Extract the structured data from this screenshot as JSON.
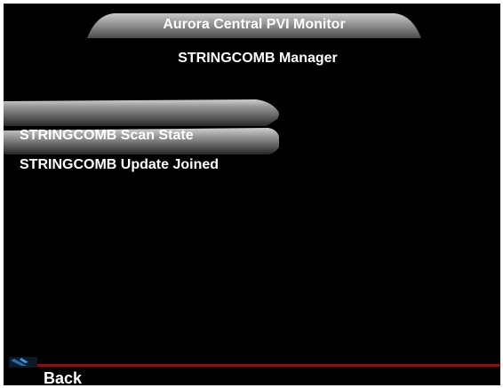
{
  "header": {
    "title": "Aurora Central PVI Monitor",
    "subtitle": "STRINGCOMB Manager"
  },
  "menu": {
    "items": [
      {
        "label": "STRINGCOMB Scan State",
        "selected": true
      },
      {
        "label": "STRINGCOMB Update Joined",
        "selected": false
      }
    ]
  },
  "footer": {
    "back_label": "Back"
  },
  "colors": {
    "background": "#000000",
    "frame": "#ffffff",
    "text": "#ffffff",
    "bar_light": "#b8b8b8",
    "bar_dark": "#2e2e2e",
    "accent_line": "#8b0e10",
    "icon_blue": "#1c6fb0"
  }
}
